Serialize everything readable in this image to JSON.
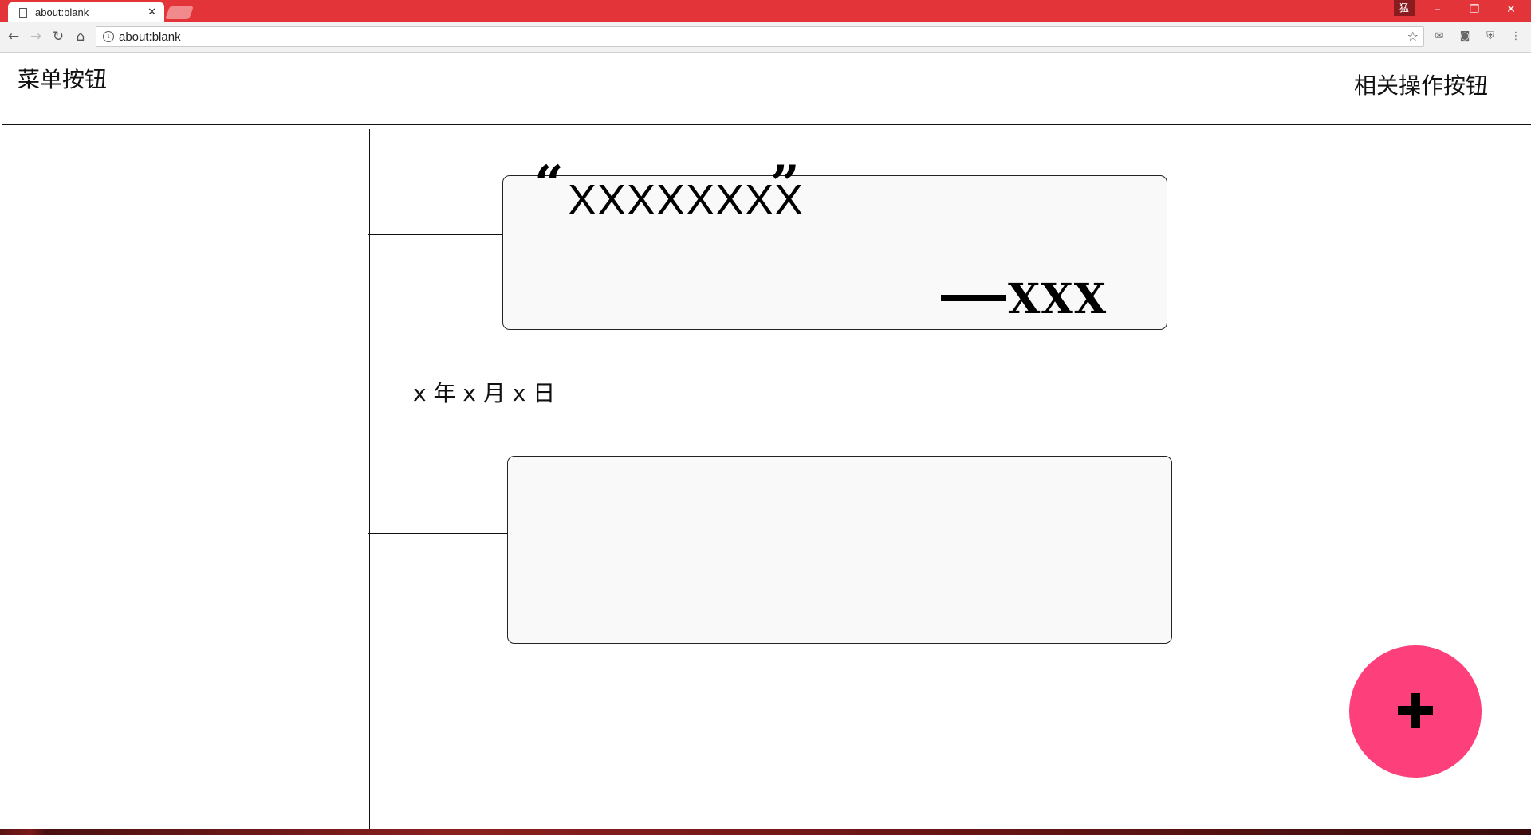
{
  "browser": {
    "tab_title": "about:blank",
    "tab_close": "✕",
    "url": "about:blank",
    "profile_badge": "猛",
    "window_minimize": "–",
    "window_restore": "❐",
    "window_close": "✕"
  },
  "header": {
    "menu_button": "菜单按钮",
    "action_button": "相关操作按钮"
  },
  "timeline": {
    "entry1": {
      "open_quote": "“",
      "quote": "XXXXXXXX",
      "close_quote": "”",
      "dash": "——",
      "author": "XXX"
    },
    "date": "x 年 x 月 x 日"
  },
  "fab": {
    "icon": "plus-icon",
    "color": "#fd3f7b"
  },
  "colors": {
    "titlebar": "#e3343a",
    "card_bg": "#f9f9f9"
  }
}
